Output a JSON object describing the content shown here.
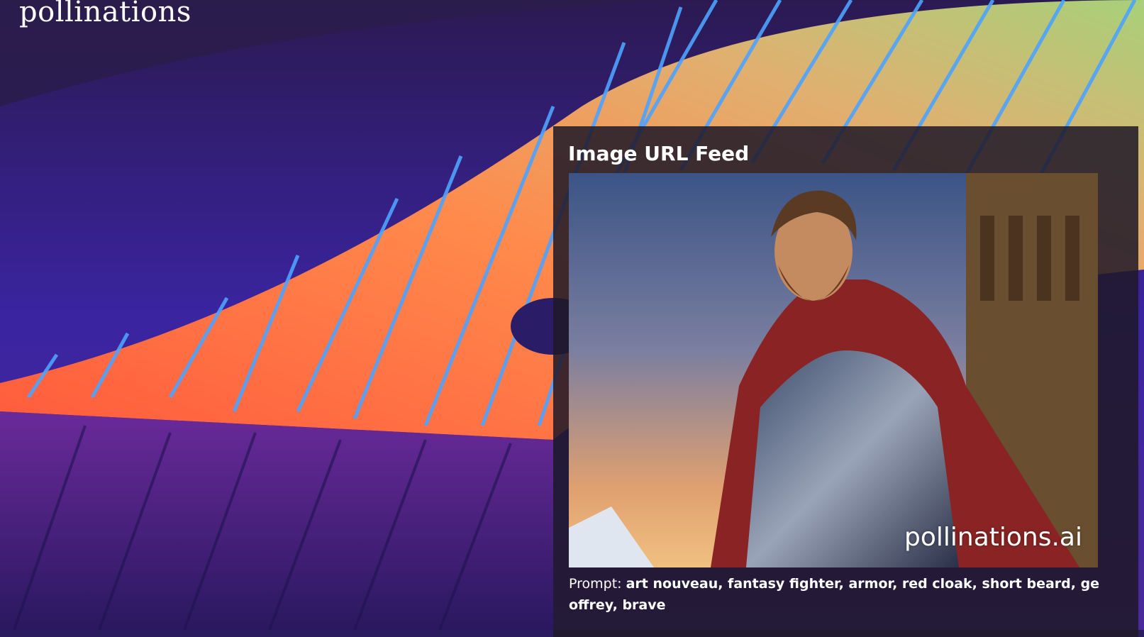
{
  "brand": {
    "logo_text": "pollinations"
  },
  "feed": {
    "title": "Image URL Feed",
    "image_alt_icon": "generated-fantasy-fighter-image",
    "watermark": "pollinations.ai",
    "prompt_label": "Prompt:",
    "prompt_text": "art nouveau, fantasy fighter, armor, red cloak, short beard, geoffrey, brave"
  },
  "colors": {
    "background_top": "#2a1c5e",
    "accent_orange": "#ff7a4a",
    "accent_blue": "#4da3ff",
    "panel_bg": "#1e1828"
  }
}
